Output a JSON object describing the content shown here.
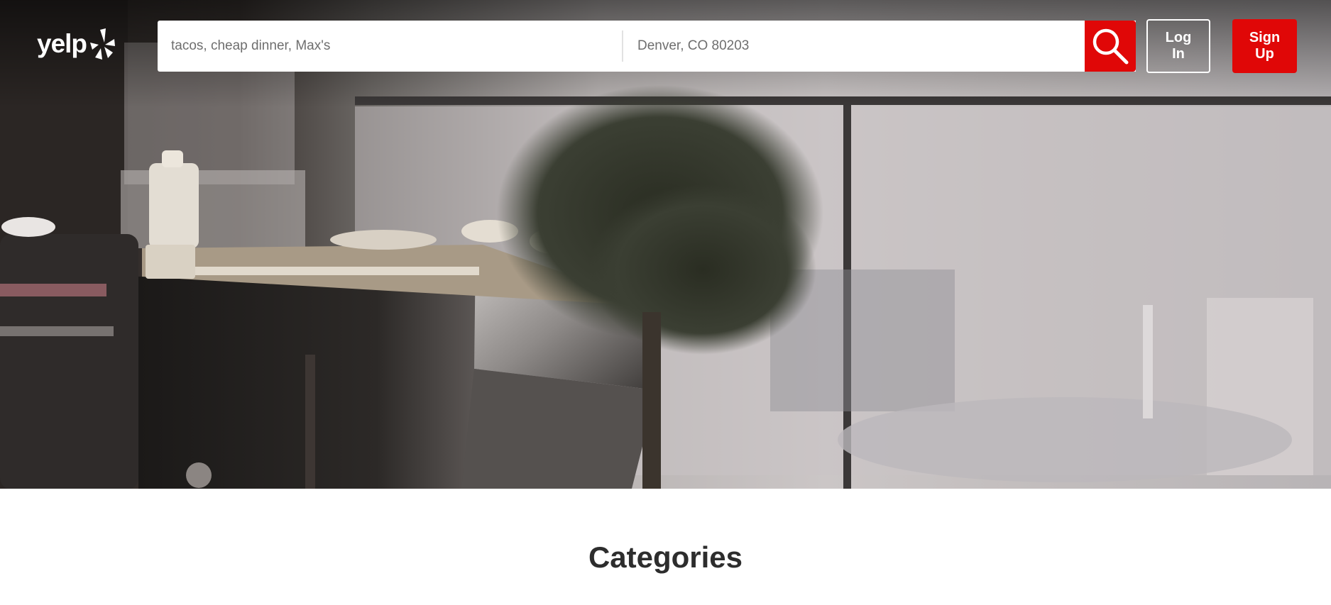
{
  "header": {
    "logo_text": "yelp",
    "logo_icon": "yelp-burst-icon",
    "search": {
      "find_placeholder": "tacos, cheap dinner, Max's",
      "near_placeholder": "Denver, CO 80203",
      "search_icon": "search-icon"
    },
    "login_label": "Log In",
    "signup_label": "Sign Up"
  },
  "hero": {
    "image": "coffee-shop-espresso-machine-photo"
  },
  "main": {
    "section_title": "Categories"
  },
  "colors": {
    "brand_red": "#e00707",
    "text_dark": "#2d2d2d"
  }
}
